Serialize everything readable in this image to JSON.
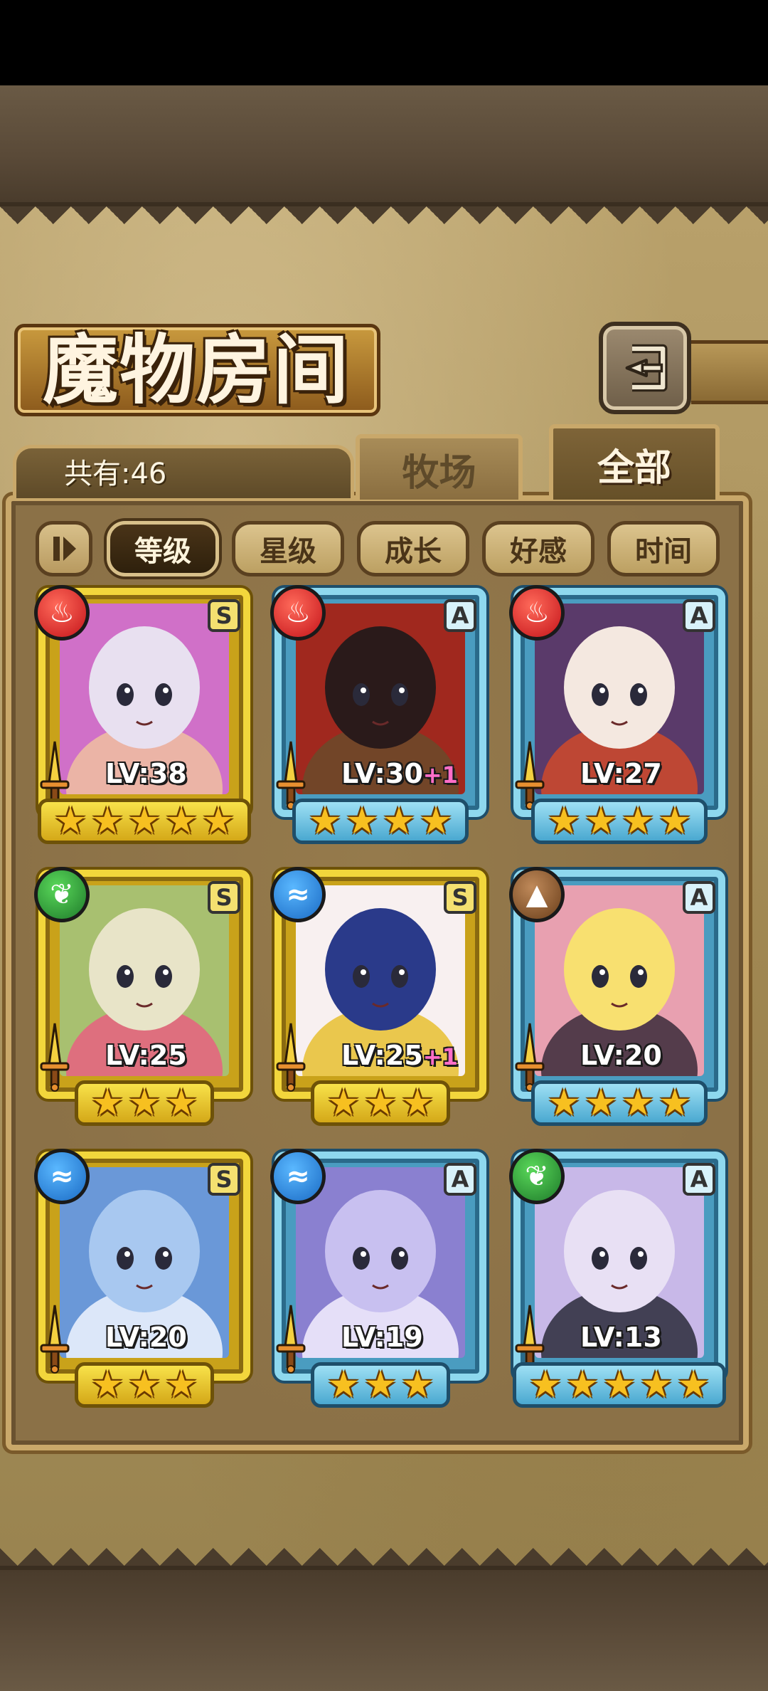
{
  "header": {
    "title": "魔物房间",
    "count_label": "共有:46"
  },
  "tabs": [
    {
      "label": "牧场",
      "active": false
    },
    {
      "label": "全部",
      "active": true
    }
  ],
  "sort_buttons": [
    {
      "label": "等级",
      "active": true
    },
    {
      "label": "星级",
      "active": false
    },
    {
      "label": "成长",
      "active": false
    },
    {
      "label": "好感",
      "active": false
    },
    {
      "label": "时间",
      "active": false
    }
  ],
  "monsters": [
    {
      "element": "fire",
      "rank": "S",
      "level": "LV:38",
      "bonus": "",
      "stars": 5,
      "frame": "gold",
      "colors": [
        "#e8e0f0",
        "#d070c8",
        "#f0c0a0"
      ]
    },
    {
      "element": "fire",
      "rank": "A",
      "level": "LV:30",
      "bonus": "+1",
      "stars": 4,
      "frame": "blue",
      "colors": [
        "#2a1a1a",
        "#a0281e",
        "#6a4a2a"
      ]
    },
    {
      "element": "fire",
      "rank": "A",
      "level": "LV:27",
      "bonus": "",
      "stars": 4,
      "frame": "blue",
      "colors": [
        "#f4e8e0",
        "#5a3a6a",
        "#d04a2a"
      ]
    },
    {
      "element": "wood",
      "rank": "S",
      "level": "LV:25",
      "bonus": "",
      "stars": 3,
      "frame": "gold",
      "colors": [
        "#e8e4c8",
        "#a8c070",
        "#e86080"
      ]
    },
    {
      "element": "water",
      "rank": "S",
      "level": "LV:25",
      "bonus": "+1",
      "stars": 3,
      "frame": "gold",
      "colors": [
        "#2a3a8a",
        "#f8f0f0",
        "#e8c030"
      ]
    },
    {
      "element": "earth",
      "rank": "A",
      "level": "LV:20",
      "bonus": "",
      "stars": 4,
      "frame": "blue",
      "colors": [
        "#f8e070",
        "#e8a0b0",
        "#3a2a3a"
      ]
    },
    {
      "element": "water",
      "rank": "S",
      "level": "LV:20",
      "bonus": "",
      "stars": 3,
      "frame": "gold",
      "colors": [
        "#a8c8f0",
        "#6a98d8",
        "#f0f4ff"
      ]
    },
    {
      "element": "water",
      "rank": "A",
      "level": "LV:19",
      "bonus": "",
      "stars": 3,
      "frame": "blue",
      "colors": [
        "#c8c0f0",
        "#8a80d0",
        "#f4f0ff"
      ]
    },
    {
      "element": "wood",
      "rank": "A",
      "level": "LV:13",
      "bonus": "",
      "stars": 5,
      "frame": "blue",
      "colors": [
        "#e8e0f4",
        "#c8b8e8",
        "#2a2a3a"
      ]
    }
  ],
  "icons": {
    "back": "back-arrow-icon",
    "sort_toggle": "sort-order-icon",
    "fire": "flame-icon",
    "water": "wave-icon",
    "wood": "leaf-icon",
    "earth": "mountain-icon",
    "weapon": "sword-icon",
    "star": "star-icon"
  },
  "colors": {
    "gold_frame": "#f2d63c",
    "blue_frame": "#8ed8ee",
    "parchment": "#b8a06a",
    "panel": "#8b7147"
  }
}
